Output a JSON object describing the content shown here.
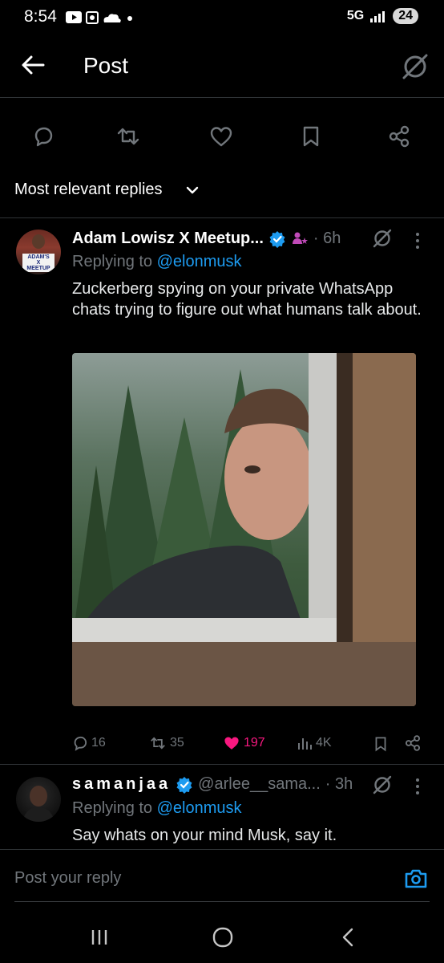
{
  "status": {
    "time": "8:54",
    "network": "5G",
    "battery": "24"
  },
  "header": {
    "title": "Post"
  },
  "actions": [
    "reply",
    "repost",
    "like",
    "bookmark",
    "share"
  ],
  "sort": {
    "label": "Most relevant replies"
  },
  "reply1": {
    "name": "Adam Lowisz X Meetup...",
    "dot_time": "· 6h",
    "replying_prefix": "Replying to",
    "replying_handle": "@elonmusk",
    "text": "Zuckerberg spying on your private WhatsApp chats trying to figure out what humans talk about.",
    "avatar_sign": "ADAM'S X MEETUP",
    "metrics": {
      "replies": "16",
      "reposts": "35",
      "likes": "197",
      "views": "4K"
    }
  },
  "reply2": {
    "name": "samanjaa",
    "handle": "@arlee__sama...",
    "dot_time": "· 3h",
    "replying_prefix": "Replying to",
    "replying_handle": "@elonmusk",
    "text": "Say whats on your mind Musk, say it."
  },
  "compose": {
    "placeholder": "Post your reply"
  },
  "colors": {
    "accent": "#1d9bf0",
    "like": "#f91880",
    "muted": "#71767b",
    "verified": "#1d9bf0",
    "badge": "#c04ab8"
  }
}
